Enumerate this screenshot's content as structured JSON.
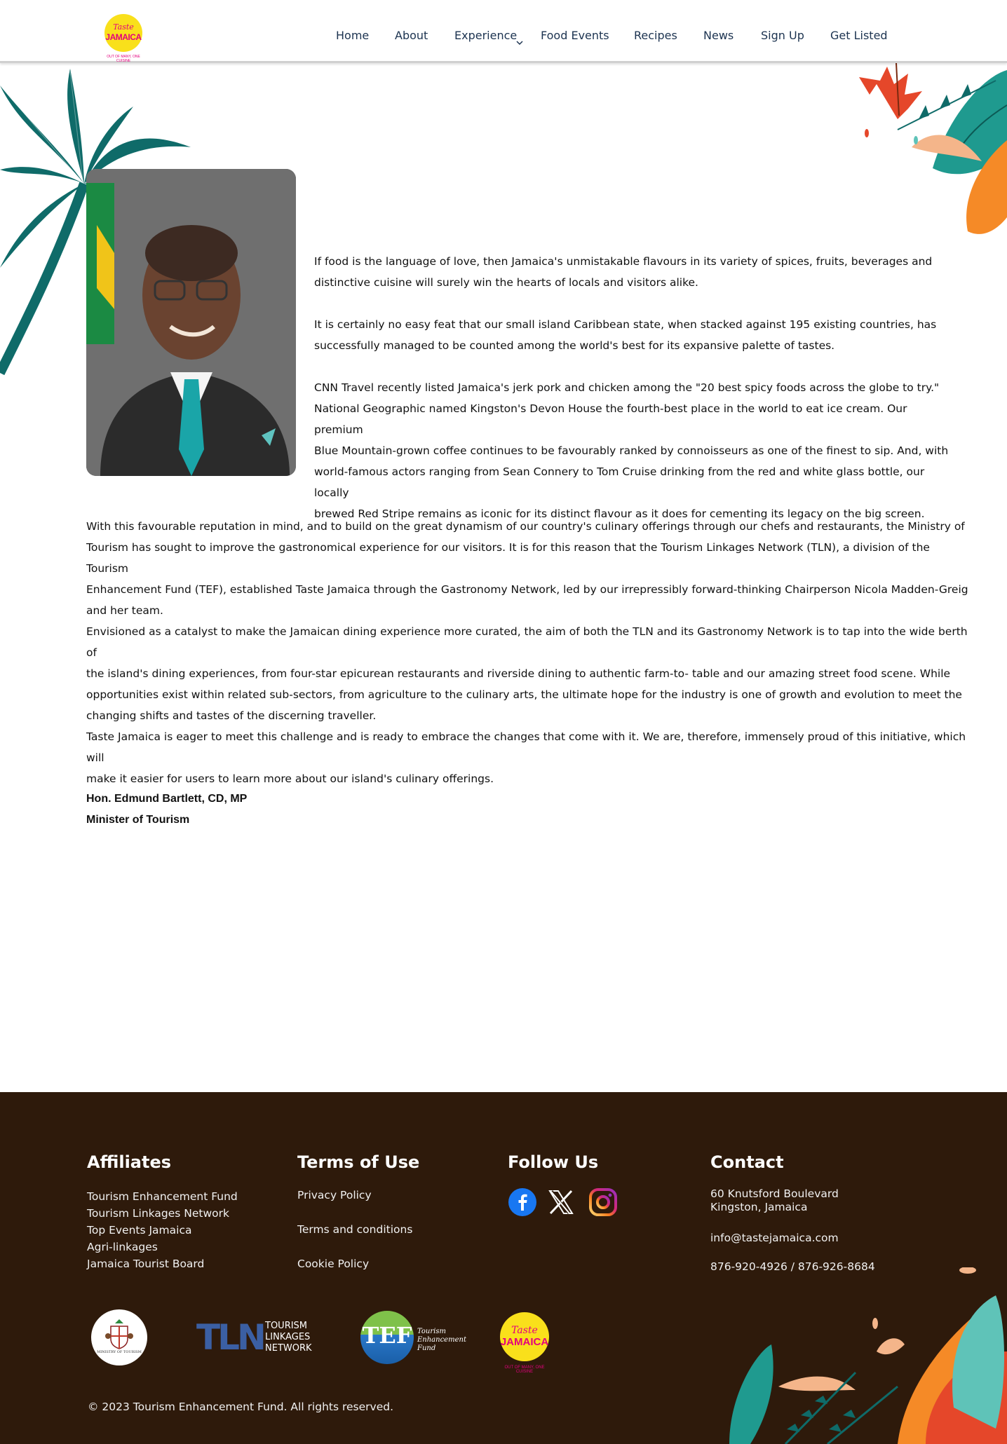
{
  "header": {
    "logo": {
      "taste": "Taste",
      "jamaica": "JAMAICA",
      "tagline": "OUT OF MANY, ONE CUISINE"
    },
    "nav": [
      "Home",
      "About",
      "Experience",
      "Food Events",
      "Recipes",
      "News",
      "Sign Up",
      "Get Listed"
    ]
  },
  "main": {
    "paragraphs_right": [
      [
        "If food is the language of love, then Jamaica's unmistakable flavours in its variety of spices, fruits, beverages and",
        "distinctive cuisine will surely win the hearts of locals and visitors alike."
      ],
      [
        "It is certainly no easy feat that our small island Caribbean state, when stacked against 195 existing countries, has",
        "successfully managed to be counted among the world's best for its expansive palette of tastes."
      ],
      [
        "CNN Travel recently listed Jamaica's jerk pork and chicken among the \"20 best spicy foods across the globe to try.\"",
        "National Geographic named Kingston's Devon House the fourth-best place in the world to eat ice cream. Our premium",
        "Blue Mountain-grown coffee continues to be favourably ranked by connoisseurs as one of the finest to sip. And, with",
        "world-famous actors ranging from Sean Connery to Tom Cruise drinking from the red and white glass bottle, our locally",
        "brewed Red Stripe remains as iconic for its distinct flavour as it does for cementing its legacy on the big screen."
      ]
    ],
    "paragraphs_full": [
      [
        "With this favourable reputation in mind, and to build on the great dynamism of our country's culinary offerings through our chefs and restaurants, the Ministry of",
        "Tourism has sought to improve the gastronomical experience for our visitors. It is for this reason that the Tourism Linkages Network (TLN), a division of the Tourism",
        "Enhancement Fund (TEF), established Taste Jamaica through the Gastronomy Network, led by our irrepressibly forward-thinking Chairperson Nicola Madden-Greig",
        "and her team."
      ],
      [
        "Envisioned as a catalyst to make the Jamaican dining experience more curated, the aim of both the TLN and its Gastronomy Network is to tap into the wide berth of",
        "the island's dining experiences, from four-star epicurean restaurants and riverside dining to authentic farm-to- table and our amazing street food scene. While",
        "opportunities exist within related sub-sectors, from agriculture to the culinary arts, the ultimate hope for the industry is one of growth and evolution to meet the",
        "changing shifts and tastes of the discerning traveller."
      ],
      [
        "Taste Jamaica is eager to meet this challenge and is ready to embrace the changes that come with it. We are, therefore, immensely proud of this initiative, which will",
        "make it easier for users to learn more about our island's culinary offerings."
      ]
    ],
    "signature": {
      "name": "Hon. Edmund Bartlett, CD, MP",
      "title": "Minister of Tourism"
    }
  },
  "footer": {
    "affiliates": {
      "title": "Affiliates",
      "links": [
        "Tourism Enhancement Fund",
        "Tourism Linkages Network",
        "Top Events Jamaica",
        "Agri-linkages",
        "Jamaica Tourist Board"
      ]
    },
    "terms": {
      "title": "Terms of Use",
      "links": [
        "Privacy Policy",
        "Terms and conditions",
        "Cookie Policy"
      ]
    },
    "follow": {
      "title": "Follow Us",
      "icons": [
        "facebook-icon",
        "x-twitter-icon",
        "instagram-icon"
      ]
    },
    "contact": {
      "title": "Contact",
      "address_line1": "60 Knutsford Boulevard",
      "address_line2": "Kingston, Jamaica",
      "email": "info@tastejamaica.com",
      "phone": "876-920-4926 / 876-926-8684"
    },
    "logos": {
      "ministry": "MINISTRY OF TOURISM",
      "tln": {
        "mark": "TLN",
        "line1": "TOURISM",
        "line2": "LINKAGES",
        "line3": "NETWORK"
      },
      "tef": {
        "mark": "TEF",
        "line1": "Tourism",
        "line2": "Enhancement",
        "line3": "Fund"
      },
      "taste": {
        "taste": "Taste",
        "jamaica": "JAMAICA",
        "tagline": "OUT OF MANY, ONE CUISINE"
      }
    },
    "copyright": "© 2023 Tourism Enhancement Fund.  All rights reserved."
  },
  "colors": {
    "footer_bg": "#2e1a0b",
    "nav_text": "#1c3350",
    "brand_pink": "#e3007e",
    "brand_yellow": "#f9e01b",
    "palm_teal": "#0f6b69"
  }
}
